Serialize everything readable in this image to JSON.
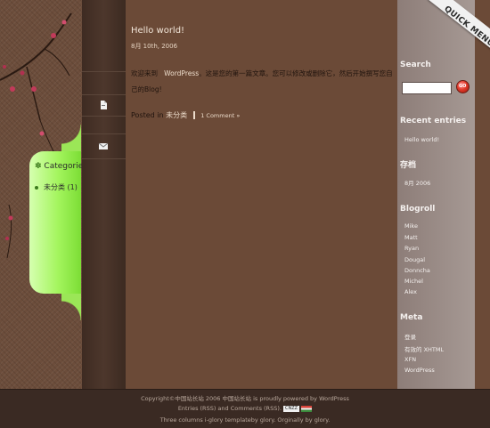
{
  "quick_menu": {
    "label": "QUICK MENU"
  },
  "categories": {
    "title": "Categories",
    "items": [
      {
        "label": "未分类",
        "count": "(1)"
      }
    ]
  },
  "icon_column": {
    "icons": [
      "document-icon",
      "mail-icon"
    ]
  },
  "post": {
    "title": "Hello world!",
    "date": "8月 10th, 2006",
    "body_prefix": "欢迎来到",
    "body_highlight": "WordPress",
    "body_rest": "。这是您的第一篇文章。您可以修改或删除它，然后开始撰写您自己的Blog!",
    "posted_in_label": "Posted in",
    "category": "未分类",
    "comments": "1 Comment »"
  },
  "sidebar": {
    "search": {
      "title": "Search",
      "value": "",
      "button_label": "GO"
    },
    "recent": {
      "title": "Recent entries",
      "items": [
        "Hello world!"
      ]
    },
    "archives": {
      "title": "存档",
      "items": [
        "8月 2006"
      ]
    },
    "blogroll": {
      "title": "Blogroll",
      "items": [
        "Mike",
        "Matt",
        "Ryan",
        "Dougal",
        "Donncha",
        "Michel",
        "Alex"
      ]
    },
    "meta": {
      "title": "Meta",
      "items": [
        "登录",
        "有效的 XHTML",
        "XFN",
        "WordPress"
      ]
    }
  },
  "footer": {
    "line1": "Copyright©中国站长站 2006 中国站长站  is proudly powered by WordPress",
    "line2": "Entries (RSS) and Comments (RSS).",
    "badge_text": "CNZZ",
    "line3": "Three columns i-glory templateby glory. Orginally by glory."
  },
  "colors": {
    "background": "#6b4a37",
    "icon_column": "#4d372c",
    "sidebar": "#9c8e89",
    "category_tab": "#a4f55e",
    "footer": "#3a2a23"
  }
}
